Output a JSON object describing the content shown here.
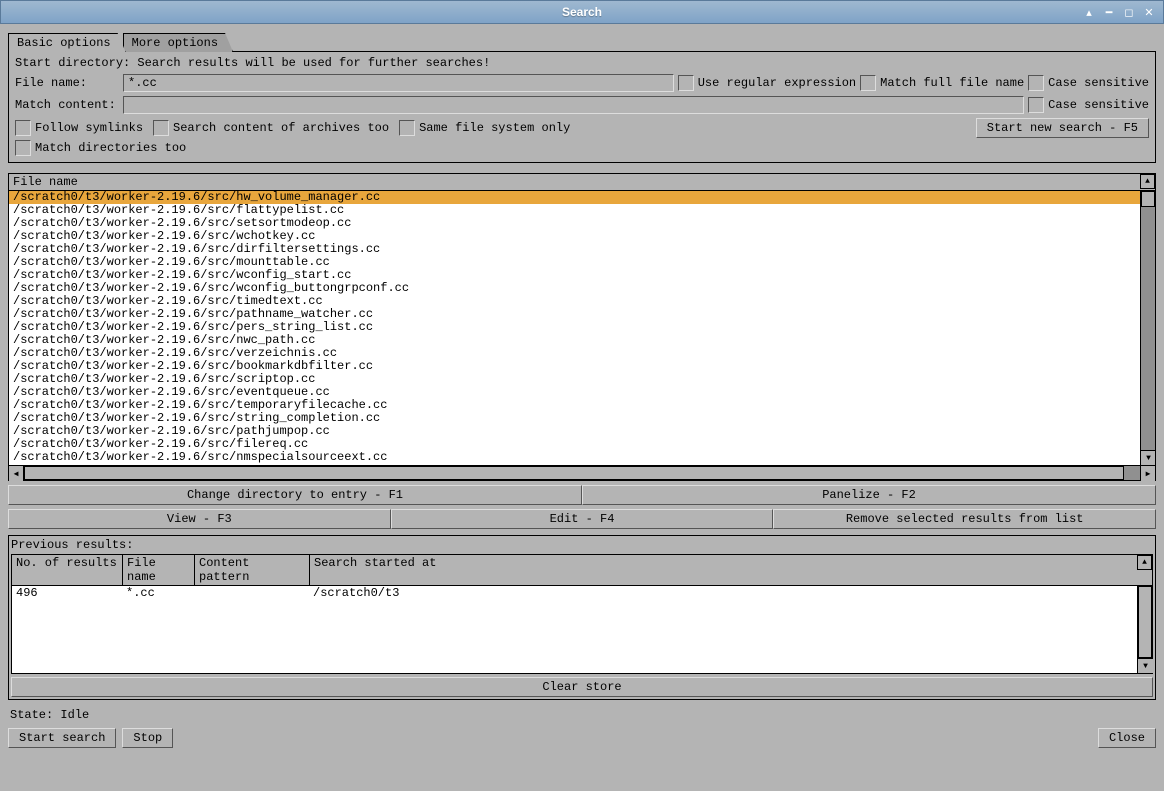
{
  "window": {
    "title": "Search"
  },
  "tabs": {
    "basic": "Basic options",
    "more": "More options"
  },
  "options": {
    "info": "Start directory: Search results will be used for further searches!",
    "filename_label": "File name:",
    "filename_value": "*.cc",
    "regex_label": "Use regular expression",
    "match_full_label": "Match full file name",
    "case_sensitive_label": "Case sensitive",
    "match_content_label": "Match content:",
    "match_content_value": "",
    "case_sensitive2_label": "Case sensitive",
    "follow_symlinks": "Follow symlinks",
    "search_archives": "Search content of archives too",
    "same_fs": "Same file system only",
    "start_search": "Start new search - F5",
    "match_dirs": "Match directories too"
  },
  "results": {
    "header": "File name",
    "rows": [
      "/scratch0/t3/worker-2.19.6/src/hw_volume_manager.cc",
      "/scratch0/t3/worker-2.19.6/src/flattypelist.cc",
      "/scratch0/t3/worker-2.19.6/src/setsortmodeop.cc",
      "/scratch0/t3/worker-2.19.6/src/wchotkey.cc",
      "/scratch0/t3/worker-2.19.6/src/dirfiltersettings.cc",
      "/scratch0/t3/worker-2.19.6/src/mounttable.cc",
      "/scratch0/t3/worker-2.19.6/src/wconfig_start.cc",
      "/scratch0/t3/worker-2.19.6/src/wconfig_buttongrpconf.cc",
      "/scratch0/t3/worker-2.19.6/src/timedtext.cc",
      "/scratch0/t3/worker-2.19.6/src/pathname_watcher.cc",
      "/scratch0/t3/worker-2.19.6/src/pers_string_list.cc",
      "/scratch0/t3/worker-2.19.6/src/nwc_path.cc",
      "/scratch0/t3/worker-2.19.6/src/verzeichnis.cc",
      "/scratch0/t3/worker-2.19.6/src/bookmarkdbfilter.cc",
      "/scratch0/t3/worker-2.19.6/src/scriptop.cc",
      "/scratch0/t3/worker-2.19.6/src/eventqueue.cc",
      "/scratch0/t3/worker-2.19.6/src/temporaryfilecache.cc",
      "/scratch0/t3/worker-2.19.6/src/string_completion.cc",
      "/scratch0/t3/worker-2.19.6/src/pathjumpop.cc",
      "/scratch0/t3/worker-2.19.6/src/filereq.cc",
      "/scratch0/t3/worker-2.19.6/src/nmspecialsourceext.cc"
    ]
  },
  "buttons": {
    "cd_entry": "Change directory to entry - F1",
    "panelize": "Panelize - F2",
    "view": "View - F3",
    "edit": "Edit - F4",
    "remove": "Remove selected results from list",
    "clear_store": "Clear store",
    "start_search": "Start search",
    "stop": "Stop",
    "close": "Close"
  },
  "previous": {
    "title": "Previous results:",
    "headers": [
      "No. of results",
      "File name",
      "Content pattern",
      "Search started at"
    ],
    "rows": [
      {
        "count": "496",
        "filename": "*.cc",
        "pattern": "",
        "started": "/scratch0/t3"
      }
    ]
  },
  "state": {
    "label": "State:",
    "value": "Idle"
  }
}
